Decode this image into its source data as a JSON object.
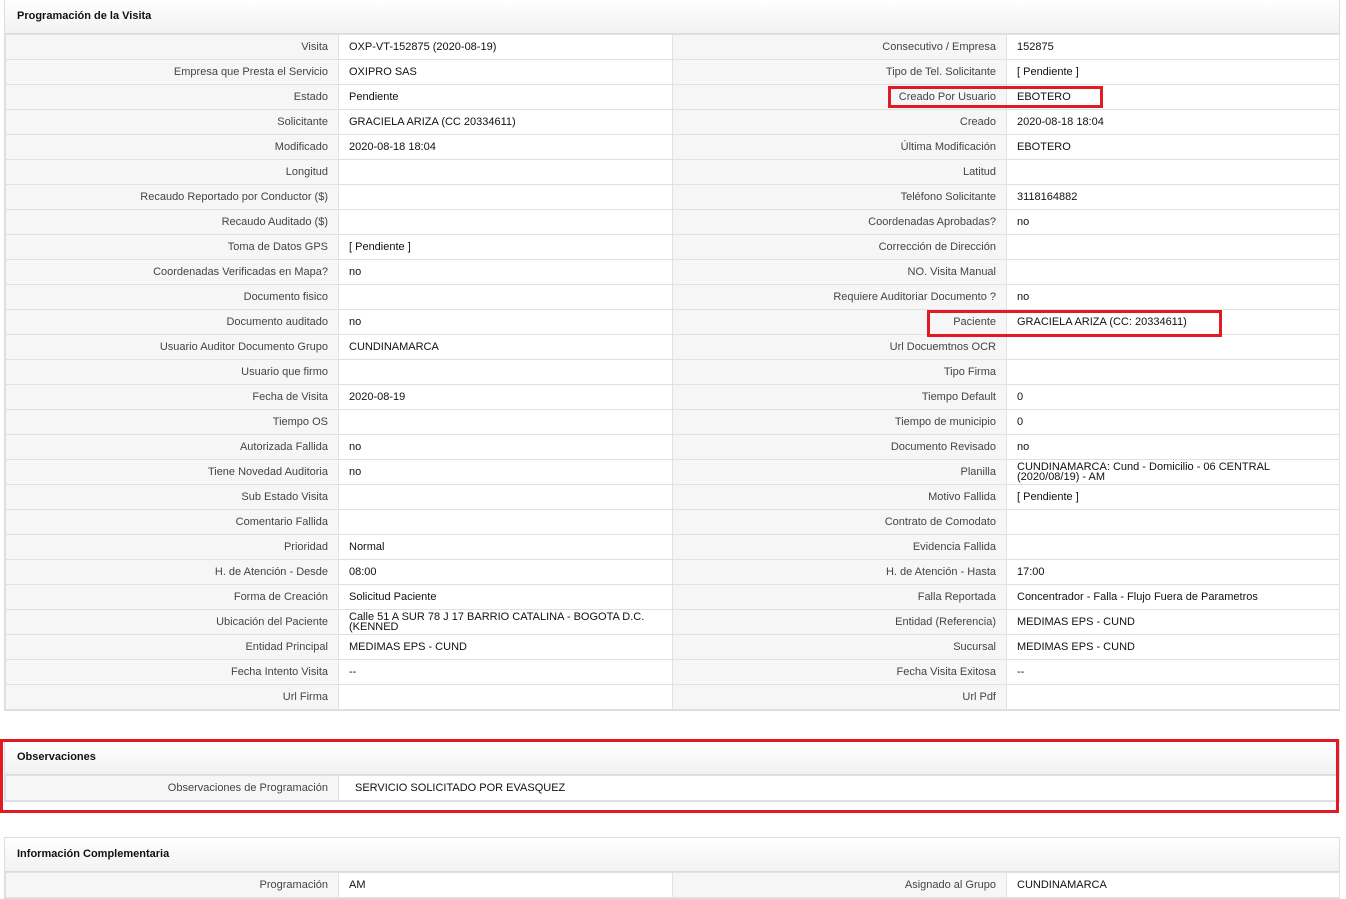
{
  "programacion": {
    "title": "Programación de la Visita",
    "rows": [
      {
        "l1": "Visita",
        "v1": "OXP-VT-152875 (2020-08-19)",
        "l2": "Consecutivo / Empresa",
        "v2": "152875"
      },
      {
        "l1": "Empresa que Presta el Servicio",
        "v1": "OXIPRO SAS",
        "l2": "Tipo de Tel. Solicitante",
        "v2": "[ Pendiente ]"
      },
      {
        "l1": "Estado",
        "v1": "Pendiente",
        "l2": "Creado Por Usuario",
        "v2": "EBOTERO"
      },
      {
        "l1": "Solicitante",
        "v1": "GRACIELA ARIZA (CC 20334611)",
        "l2": "Creado",
        "v2": "2020-08-18 18:04"
      },
      {
        "l1": "Modificado",
        "v1": "2020-08-18 18:04",
        "l2": "Última Modificación",
        "v2": " EBOTERO"
      },
      {
        "l1": "Longitud",
        "v1": "",
        "l2": "Latitud",
        "v2": ""
      },
      {
        "l1": "Recaudo Reportado por Conductor ($)",
        "v1": "",
        "l2": "Teléfono Solicitante",
        "v2": "3118164882"
      },
      {
        "l1": "Recaudo Auditado ($)",
        "v1": "",
        "l2": "Coordenadas Aprobadas?",
        "v2": " no"
      },
      {
        "l1": "Toma de Datos GPS",
        "v1": "[ Pendiente ]",
        "l2": "Corrección de Dirección",
        "v2": ""
      },
      {
        "l1": "Coordenadas Verificadas en Mapa?",
        "v1": " no",
        "l2": "NO. Visita Manual",
        "v2": ""
      },
      {
        "l1": "Documento fisico",
        "v1": "",
        "l2": "Requiere Auditoriar Documento ?",
        "v2": " no"
      },
      {
        "l1": "Documento auditado",
        "v1": " no",
        "l2": "Paciente",
        "v2": "GRACIELA ARIZA (CC: 20334611)"
      },
      {
        "l1": "Usuario Auditor Documento Grupo",
        "v1": "CUNDINAMARCA",
        "l2": "Url Docuemtnos OCR",
        "v2": ""
      },
      {
        "l1": "Usuario que firmo",
        "v1": "",
        "l2": "Tipo Firma",
        "v2": ""
      },
      {
        "l1": "Fecha de Visita",
        "v1": " 2020-08-19",
        "l2": "Tiempo Default",
        "v2": "0"
      },
      {
        "l1": "Tiempo OS",
        "v1": "",
        "l2": "Tiempo de municipio",
        "v2": "0"
      },
      {
        "l1": "Autorizada Fallida",
        "v1": " no",
        "l2": "Documento Revisado",
        "v2": " no"
      },
      {
        "l1": "Tiene Novedad Auditoria",
        "v1": " no",
        "l2": "Planilla",
        "v2": "CUNDINAMARCA: Cund - Domicilio - 06 CENTRAL (2020/08/19) - AM"
      },
      {
        "l1": "Sub Estado Visita",
        "v1": "",
        "l2": "Motivo Fallida",
        "v2": "[ Pendiente ]"
      },
      {
        "l1": "Comentario Fallida",
        "v1": "",
        "l2": "Contrato de Comodato",
        "v2": ""
      },
      {
        "l1": "Prioridad",
        "v1": "Normal",
        "l2": "Evidencia Fallida",
        "v2": ""
      },
      {
        "l1": "H. de Atención - Desde",
        "v1": "08:00",
        "l2": "H. de Atención - Hasta",
        "v2": "17:00"
      },
      {
        "l1": "Forma de Creación",
        "v1": "Solicitud Paciente",
        "l2": "Falla Reportada",
        "v2": "Concentrador - Falla - Flujo Fuera de Parametros"
      },
      {
        "l1": "Ubicación del Paciente",
        "v1": "Calle 51 A SUR 78 J 17 BARRIO CATALINA - BOGOTA D.C. (KENNED",
        "l2": "Entidad (Referencia)",
        "v2": "MEDIMAS EPS - CUND"
      },
      {
        "l1": "Entidad Principal",
        "v1": "MEDIMAS EPS - CUND",
        "l2": "Sucursal",
        "v2": "MEDIMAS EPS - CUND"
      },
      {
        "l1": "Fecha Intento Visita",
        "v1": " --",
        "l2": "Fecha Visita Exitosa",
        "v2": " --"
      },
      {
        "l1": "Url Firma",
        "v1": "",
        "l2": "Url Pdf",
        "v2": ""
      }
    ]
  },
  "observaciones": {
    "title": "Observaciones",
    "label": "Observaciones de Programación",
    "value": "SERVICIO SOLICITADO POR EVASQUEZ"
  },
  "informacion": {
    "title": "Información Complementaria",
    "row": {
      "l1": "Programación",
      "v1": "AM",
      "l2": "Asignado al Grupo",
      "v2": "CUNDINAMARCA"
    }
  },
  "colors": {
    "highlight": "#e01b24",
    "label_bg": "#f6f6f6",
    "border": "#e1e1e1"
  }
}
